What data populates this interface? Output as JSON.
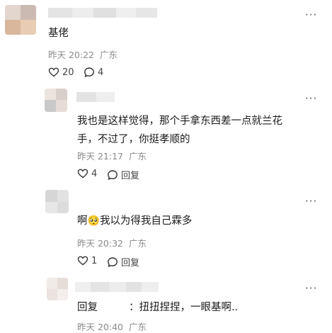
{
  "comments": [
    {
      "text": "基佬",
      "time": "昨天 20:22",
      "location": "广东",
      "likes": "20",
      "replies": "4"
    },
    {
      "text": "我也是这样觉得，那个手拿东西差一点就兰花",
      "text_line2": "手，不过了，你挺孝顺的",
      "time": "昨天 21:17",
      "location": "广东",
      "likes": "4",
      "reply_label": "回复"
    },
    {
      "text_before_emoji": "啊",
      "emoji": "🥺",
      "text_after_emoji": "我以为得我自己霖多",
      "time": "昨天 20:32",
      "location": "广东",
      "likes": "1",
      "reply_label": "回复"
    },
    {
      "reply_prefix": "回复",
      "text": "：扭扭捏捏，一眼基啊..",
      "time": "昨天 20:40",
      "location": "广东"
    }
  ],
  "icons": {
    "more": "more-horizontal-icon",
    "like": "heart-icon",
    "comment": "comment-bubble-icon"
  }
}
